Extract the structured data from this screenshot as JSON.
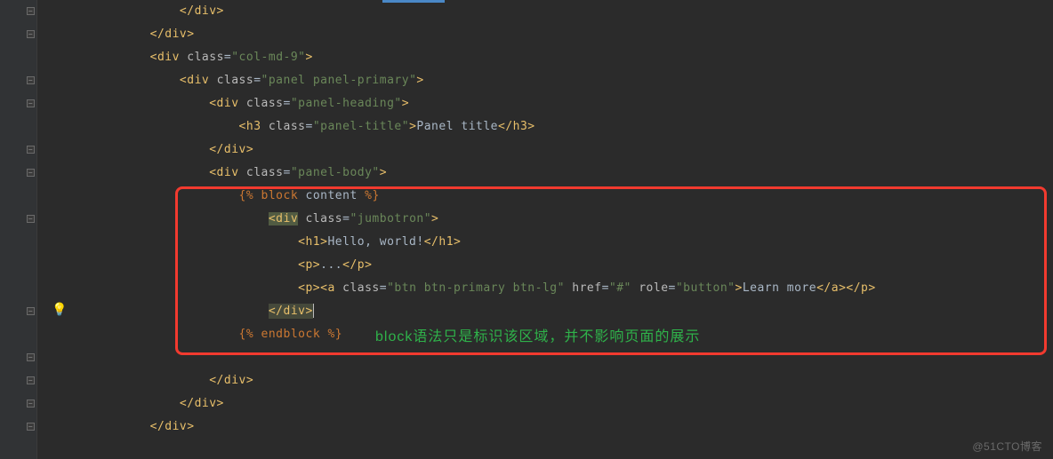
{
  "code": {
    "l1": "</div>",
    "l2": "</div>",
    "l3_open": "<div",
    "l3_attr": "class",
    "l3_val": "\"col-md-9\"",
    "l3_close": ">",
    "l4_open": "<div",
    "l4_attr": "class",
    "l4_val": "\"panel panel-primary\"",
    "l4_close": ">",
    "l5_open": "<div",
    "l5_attr": "class",
    "l5_val": "\"panel-heading\"",
    "l5_close": ">",
    "l6_open": "<h3",
    "l6_attr": "class",
    "l6_val": "\"panel-title\"",
    "l6_mid": ">",
    "l6_txt": "Panel title",
    "l6_end": "</h3>",
    "l7": "</div>",
    "l8_open": "<div",
    "l8_attr": "class",
    "l8_val": "\"panel-body\"",
    "l8_close": ">",
    "l9_o": "{%",
    "l9_kw": "block",
    "l9_name": "content",
    "l9_c": "%}",
    "l10_open": "<div",
    "l10_attr": "class",
    "l10_val": "\"jumbotron\"",
    "l10_close": ">",
    "l11_a": "<h1>",
    "l11_txt": "Hello, world!",
    "l11_b": "</h1>",
    "l12_a": "<p>",
    "l12_txt": "...",
    "l12_b": "</p>",
    "l13_a": "<p><a",
    "l13_attr1": "class",
    "l13_val1": "\"btn btn-primary btn-lg\"",
    "l13_attr2": "href",
    "l13_val2": "\"#\"",
    "l13_attr3": "role",
    "l13_val3": "\"button\"",
    "l13_mid": ">",
    "l13_txt": "Learn more",
    "l13_b": "</a></p>",
    "l14": "</div>",
    "l15_o": "{%",
    "l15_kw": "endblock",
    "l15_c": "%}",
    "l17": "</div>",
    "l18": "</div>",
    "l19": "</div>"
  },
  "annotation": "block语法只是标识该区域，并不影响页面的展示",
  "watermark": "@51CTO博客"
}
